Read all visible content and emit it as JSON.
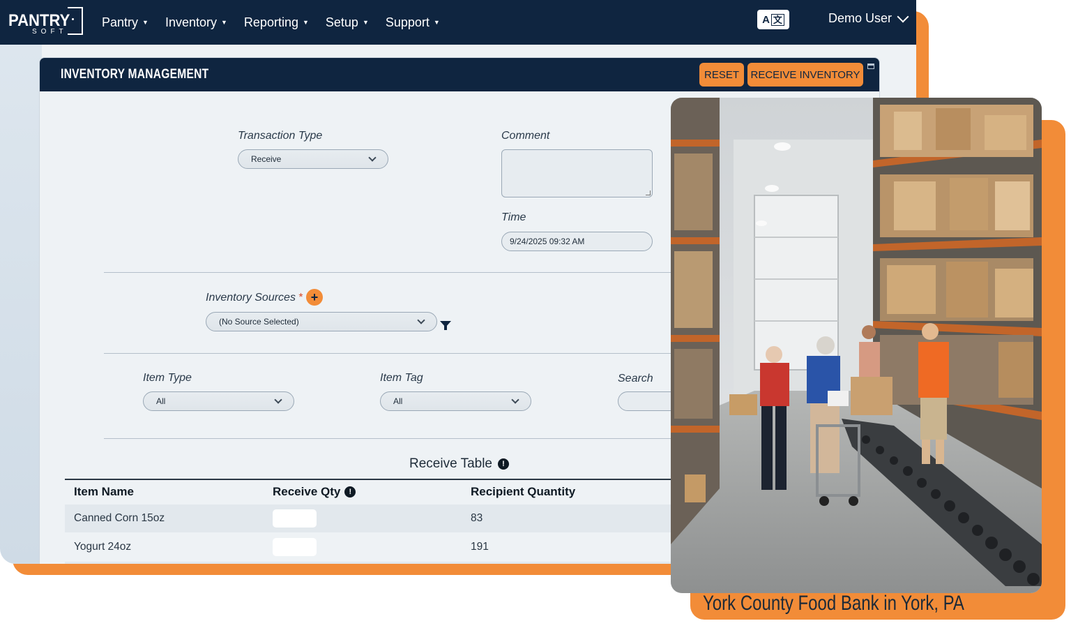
{
  "nav": {
    "logo_main": "PANTRY",
    "logo_sub": "SOFT",
    "menu": [
      {
        "label": "Pantry"
      },
      {
        "label": "Inventory"
      },
      {
        "label": "Reporting"
      },
      {
        "label": "Setup"
      },
      {
        "label": "Support"
      }
    ],
    "lang_a": "A",
    "lang_z": "文",
    "user": "Demo User"
  },
  "card": {
    "title": "INVENTORY MANAGEMENT",
    "reset_label": "RESET",
    "receive_label": "RECEIVE INVENTORY"
  },
  "form": {
    "transaction_type_label": "Transaction Type",
    "transaction_type_value": "Receive",
    "comment_label": "Comment",
    "time_label": "Time",
    "time_value": "9/24/2025 09:32 AM",
    "inventory_sources_label": "Inventory Sources",
    "required_mark": "*",
    "inventory_sources_value": "(No Source Selected)",
    "item_type_label": "Item Type",
    "item_type_value": "All",
    "item_tag_label": "Item Tag",
    "item_tag_value": "All",
    "search_label": "Search"
  },
  "table": {
    "title": "Receive Table",
    "headers": [
      "Item Name",
      "Receive Qty",
      "Recipient Quantity"
    ],
    "rows": [
      {
        "item": "Canned Corn 15oz",
        "recipient_qty": "83"
      },
      {
        "item": "Yogurt 24oz",
        "recipient_qty": "191"
      }
    ]
  },
  "photo": {
    "caption": "York County Food Bank in York, PA"
  },
  "colors": {
    "navy": "#0f2540",
    "orange": "#f28c38"
  }
}
